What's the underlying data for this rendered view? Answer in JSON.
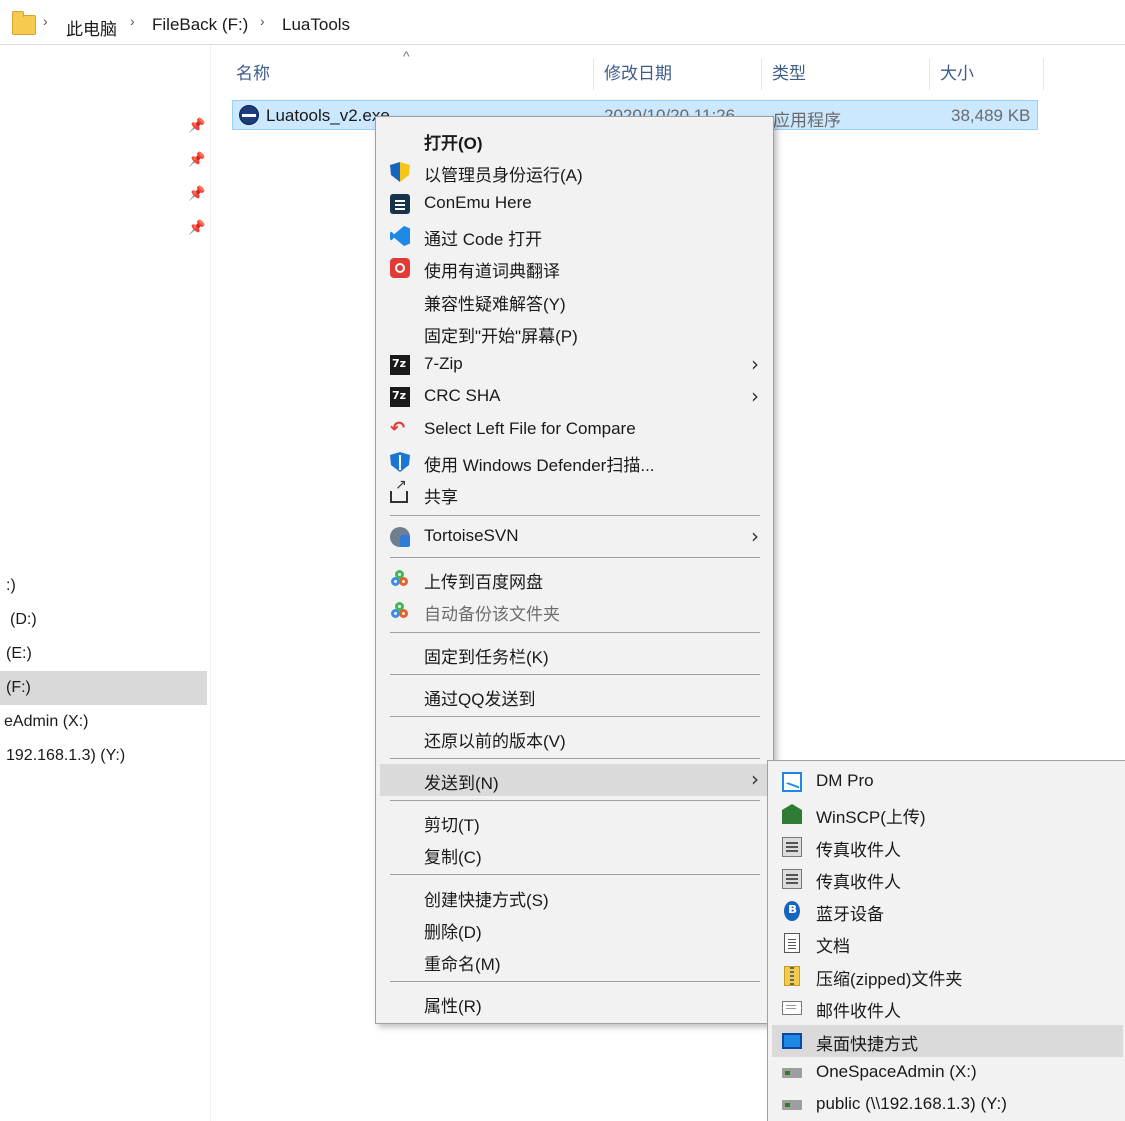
{
  "address_bar": {
    "crumbs": [
      "此电脑",
      "FileBack (F:)",
      "LuaTools"
    ],
    "separator": "›"
  },
  "nav": {
    "items": [
      {
        "label": ":)",
        "selected": false
      },
      {
        "label": "(D:)",
        "selected": false
      },
      {
        "label": "(E:)",
        "selected": false
      },
      {
        "label": "(F:)",
        "selected": true
      },
      {
        "label": "eAdmin (X:)",
        "selected": false
      },
      {
        "label": "192.168.1.3) (Y:)",
        "selected": false
      }
    ],
    "pin_glyph": "📌"
  },
  "columns": {
    "name": "名称",
    "modified": "修改日期",
    "type": "类型",
    "size": "大小",
    "sort_glyph": "^"
  },
  "file": {
    "name": "Luatools_v2.exe",
    "modified": "2020/10/20 11:26",
    "type": "应用程序",
    "size": "38,489 KB"
  },
  "context_menu": {
    "open": "打开(O)",
    "run_as_admin": "以管理员身份运行(A)",
    "conemu": "ConEmu Here",
    "open_with_code": "通过 Code 打开",
    "youdao": "使用有道词典翻译",
    "compat": "兼容性疑难解答(Y)",
    "pin_start": "固定到\"开始\"屏幕(P)",
    "zip7": "7-Zip",
    "crc": "CRC SHA",
    "compare": "Select Left File for Compare",
    "defender": "使用 Windows Defender扫描...",
    "share": "共享",
    "svn": "TortoiseSVN",
    "baidu_upload": "上传到百度网盘",
    "baidu_backup": "自动备份该文件夹",
    "pin_taskbar": "固定到任务栏(K)",
    "qq_send": "通过QQ发送到",
    "restore": "还原以前的版本(V)",
    "send_to": "发送到(N)",
    "cut": "剪切(T)",
    "copy": "复制(C)",
    "shortcut": "创建快捷方式(S)",
    "delete": "删除(D)",
    "rename": "重命名(M)",
    "properties": "属性(R)",
    "submenu_arrow": "›"
  },
  "send_to_menu": {
    "items": [
      {
        "label": "DM Pro",
        "icon": "dm-pro-icon"
      },
      {
        "label": "WinSCP(上传)",
        "icon": "winscp-icon"
      },
      {
        "label": "传真收件人",
        "icon": "fax-icon"
      },
      {
        "label": "传真收件人",
        "icon": "fax-icon"
      },
      {
        "label": "蓝牙设备",
        "icon": "bluetooth-icon"
      },
      {
        "label": "文档",
        "icon": "document-icon"
      },
      {
        "label": "压缩(zipped)文件夹",
        "icon": "zip-folder-icon"
      },
      {
        "label": "邮件收件人",
        "icon": "mail-icon"
      },
      {
        "label": "桌面快捷方式",
        "icon": "desktop-icon",
        "highlighted": true
      },
      {
        "label": "OneSpaceAdmin (X:)",
        "icon": "network-drive-icon"
      },
      {
        "label": "public (\\\\192.168.1.3) (Y:)",
        "icon": "network-drive-icon"
      }
    ]
  },
  "colors": {
    "selection_bg": "#cce8ff",
    "selection_border": "#99d1ff",
    "menu_bg": "#f2f2f2",
    "menu_highlight": "#dadada",
    "header_text": "#3e5d8a"
  }
}
